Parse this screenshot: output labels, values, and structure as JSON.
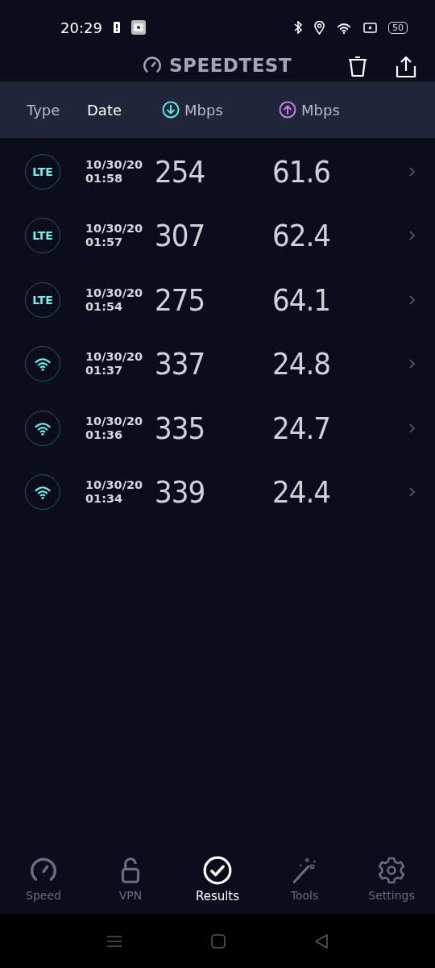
{
  "status_bar": {
    "time": "20:29",
    "battery": "50"
  },
  "header": {
    "title": "SPEEDTEST"
  },
  "columns": [
    {
      "label": "Type",
      "selected": false,
      "kind": "text"
    },
    {
      "label": "Date",
      "selected": true,
      "kind": "text"
    },
    {
      "label": "Mbps",
      "selected": false,
      "kind": "download"
    },
    {
      "label": "Mbps",
      "selected": false,
      "kind": "upload"
    }
  ],
  "rows": [
    {
      "kind": "lte",
      "type": "LTE",
      "date": "10/30/20",
      "time": "01:58",
      "download": "254",
      "upload": "61.6"
    },
    {
      "kind": "lte",
      "type": "LTE",
      "date": "10/30/20",
      "time": "01:57",
      "download": "307",
      "upload": "62.4"
    },
    {
      "kind": "lte",
      "type": "LTE",
      "date": "10/30/20",
      "time": "01:54",
      "download": "275",
      "upload": "64.1"
    },
    {
      "kind": "wifi",
      "date": "10/30/20",
      "time": "01:37",
      "download": "337",
      "upload": "24.8"
    },
    {
      "kind": "wifi",
      "date": "10/30/20",
      "time": "01:36",
      "download": "335",
      "upload": "24.7"
    },
    {
      "kind": "wifi",
      "date": "10/30/20",
      "time": "01:34",
      "download": "339",
      "upload": "24.4"
    }
  ],
  "nav": [
    {
      "label": "Speed",
      "kind": "speed",
      "selected": false
    },
    {
      "label": "VPN",
      "kind": "vpn",
      "selected": false
    },
    {
      "label": "Results",
      "kind": "results",
      "selected": true
    },
    {
      "label": "Tools",
      "kind": "tools",
      "selected": false
    },
    {
      "label": "Settings",
      "kind": "settings",
      "selected": false
    }
  ]
}
